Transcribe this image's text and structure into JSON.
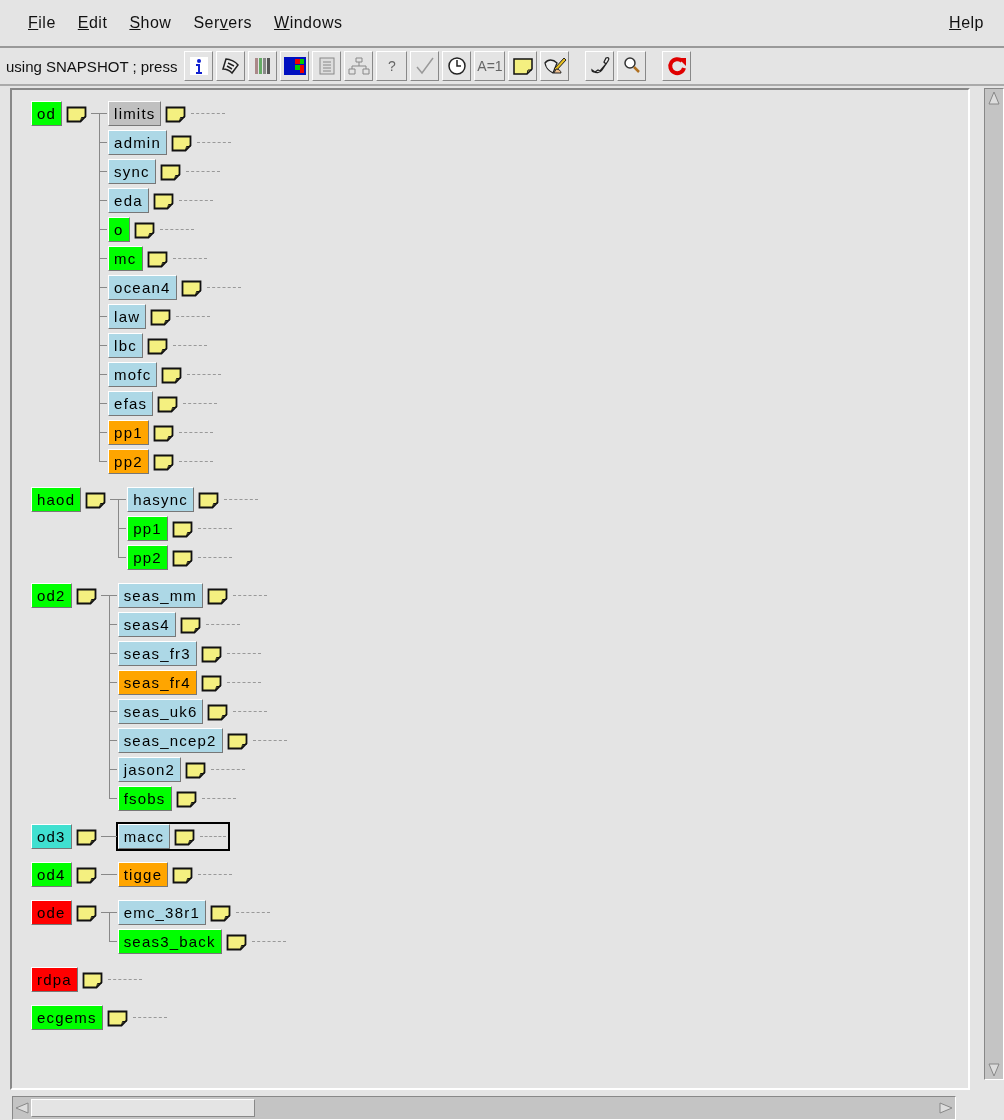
{
  "menu": [
    {
      "key": "F",
      "post": "ile"
    },
    {
      "key": "E",
      "post": "dit"
    },
    {
      "key": "S",
      "post": "how"
    },
    {
      "pre": "Ser",
      "key": "v",
      "post": "ers"
    },
    {
      "key": "W",
      "post": "indows"
    }
  ],
  "help_menu": {
    "key": "H",
    "post": "elp"
  },
  "toolbar": {
    "status": "using SNAPSHOT ; press",
    "tools": [
      {
        "kind": "info"
      },
      {
        "kind": "scroll"
      },
      {
        "kind": "bars"
      },
      {
        "kind": "grid"
      },
      {
        "kind": "page"
      },
      {
        "kind": "tree"
      },
      {
        "kind": "text",
        "label": "?"
      },
      {
        "kind": "check"
      },
      {
        "kind": "clock"
      },
      {
        "kind": "text",
        "label": "A=1"
      },
      {
        "kind": "note"
      },
      {
        "kind": "pen"
      },
      {
        "kind": "gap"
      },
      {
        "kind": "phone"
      },
      {
        "kind": "search"
      },
      {
        "kind": "gap"
      },
      {
        "kind": "reload"
      }
    ]
  },
  "tree": [
    {
      "name": "od",
      "color": "#00ff00",
      "children": [
        {
          "name": "limits",
          "color": "#c0c0c0",
          "selected": false
        },
        {
          "name": "admin",
          "color": "#add8e6",
          "selected": false
        },
        {
          "name": "sync",
          "color": "#add8e6",
          "selected": false
        },
        {
          "name": "eda",
          "color": "#add8e6",
          "selected": false
        },
        {
          "name": "o",
          "color": "#00ff00",
          "selected": false
        },
        {
          "name": "mc",
          "color": "#00ff00",
          "selected": false
        },
        {
          "name": "ocean4",
          "color": "#add8e6",
          "selected": false
        },
        {
          "name": "law",
          "color": "#add8e6",
          "selected": false
        },
        {
          "name": "lbc",
          "color": "#add8e6",
          "selected": false
        },
        {
          "name": "mofc",
          "color": "#add8e6",
          "selected": false
        },
        {
          "name": "efas",
          "color": "#add8e6",
          "selected": false
        },
        {
          "name": "pp1",
          "color": "#ffa500",
          "selected": false
        },
        {
          "name": "pp2",
          "color": "#ffa500",
          "selected": false
        }
      ]
    },
    {
      "name": "haod",
      "color": "#00ff00",
      "children": [
        {
          "name": "hasync",
          "color": "#add8e6",
          "selected": false
        },
        {
          "name": "pp1",
          "color": "#00ff00",
          "selected": false
        },
        {
          "name": "pp2",
          "color": "#00ff00",
          "selected": false
        }
      ]
    },
    {
      "name": "od2",
      "color": "#00ff00",
      "children": [
        {
          "name": "seas_mm",
          "color": "#add8e6",
          "selected": false
        },
        {
          "name": "seas4",
          "color": "#add8e6",
          "selected": false
        },
        {
          "name": "seas_fr3",
          "color": "#add8e6",
          "selected": false
        },
        {
          "name": "seas_fr4",
          "color": "#ffa500",
          "selected": false
        },
        {
          "name": "seas_uk6",
          "color": "#add8e6",
          "selected": false
        },
        {
          "name": "seas_ncep2",
          "color": "#add8e6",
          "selected": false
        },
        {
          "name": "jason2",
          "color": "#add8e6",
          "selected": false
        },
        {
          "name": "fsobs",
          "color": "#00ff00",
          "selected": false
        }
      ]
    },
    {
      "name": "od3",
      "color": "#40e0d0",
      "children": [
        {
          "name": "macc",
          "color": "#add8e6",
          "selected": true
        }
      ]
    },
    {
      "name": "od4",
      "color": "#00ff00",
      "children": [
        {
          "name": "tigge",
          "color": "#ffa500",
          "selected": false
        }
      ]
    },
    {
      "name": "ode",
      "color": "#ff0000",
      "children": [
        {
          "name": "emc_38r1",
          "color": "#add8e6",
          "selected": false
        },
        {
          "name": "seas3_back",
          "color": "#00ff00",
          "selected": false
        }
      ]
    },
    {
      "name": "rdpa",
      "color": "#ff0000"
    },
    {
      "name": "ecgems",
      "color": "#00ff00"
    }
  ]
}
